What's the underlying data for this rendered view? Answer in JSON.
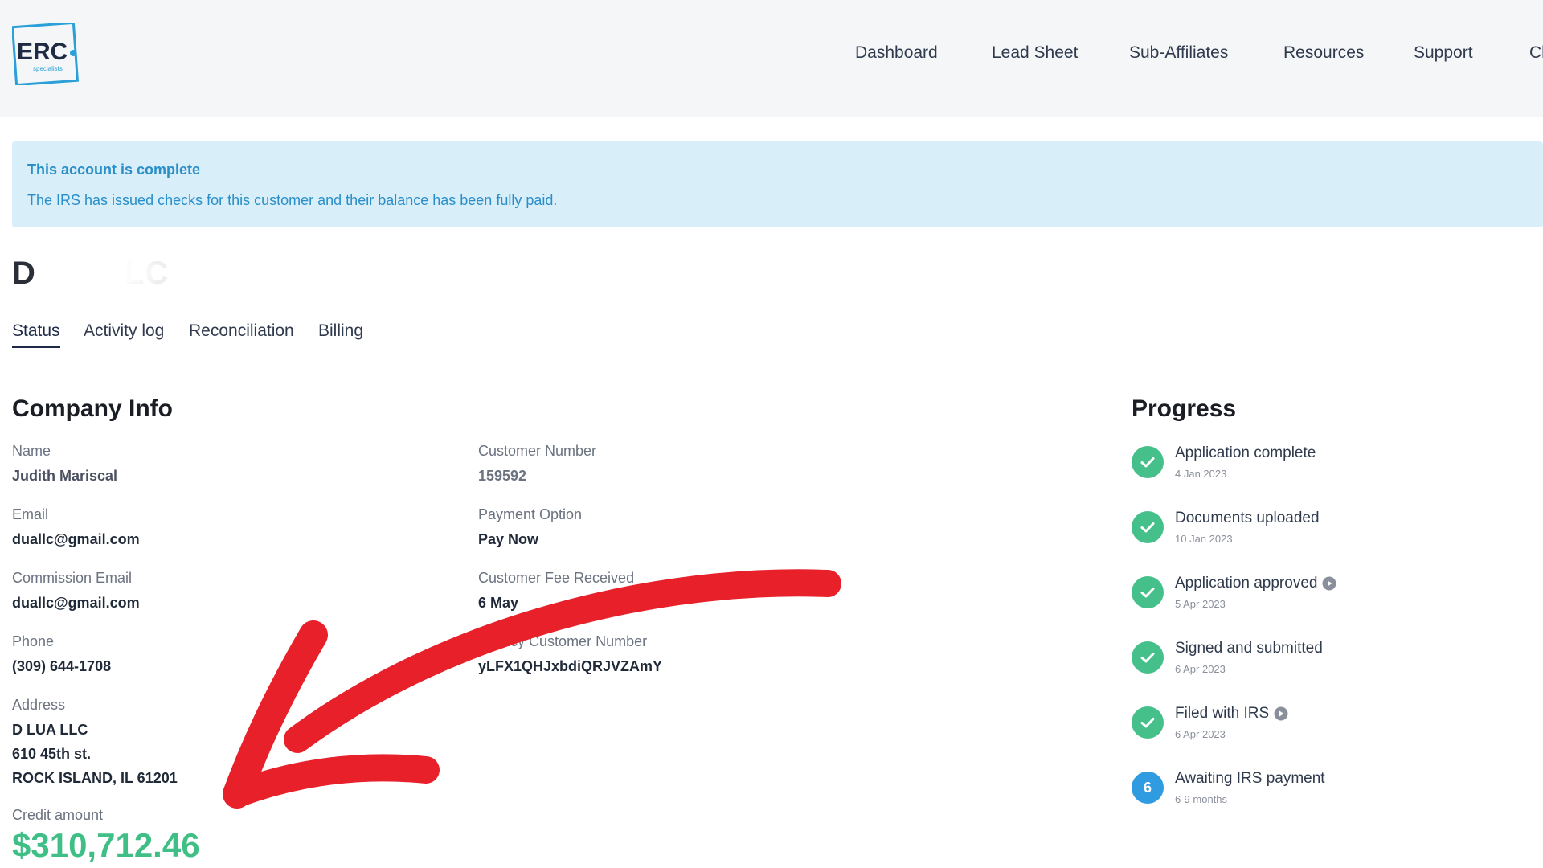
{
  "header": {
    "logo_text": "ERC",
    "logo_subtext": "specialists",
    "nav": [
      "Dashboard",
      "Lead Sheet",
      "Sub-Affiliates",
      "Resources",
      "Support",
      "Ch"
    ]
  },
  "banner": {
    "title": "This account is complete",
    "text": "The IRS has issued checks for this customer and their balance has been fully paid."
  },
  "company": {
    "title_start": "D",
    "title_end": "LC"
  },
  "tabs": [
    "Status",
    "Activity log",
    "Reconciliation",
    "Billing"
  ],
  "company_info": {
    "heading": "Company Info",
    "name_label": "Name",
    "name_value": "Judith Mariscal",
    "email_label": "Email",
    "email_value": "duallc@gmail.com",
    "commission_email_label": "Commission Email",
    "commission_email_value": "duallc@gmail.com",
    "phone_label": "Phone",
    "phone_value": "(309) 644-1708",
    "address_label": "Address",
    "address_line1": "D LUA LLC",
    "address_line2": "610 45th st.",
    "address_line3": "ROCK ISLAND, IL 61201",
    "credit_label": "Credit amount",
    "credit_value": "$310,712.46",
    "customer_number_label": "Customer Number",
    "customer_number_value": "159592",
    "payment_option_label": "Payment Option",
    "payment_option_value": "Pay Now",
    "fee_received_label": "Customer Fee Received",
    "fee_received_value": "6 May",
    "legacy_number_label": "Legacy Customer Number",
    "legacy_number_value": "yLFX1QHJxbdiQRJVZAmY"
  },
  "progress": {
    "heading": "Progress",
    "steps": [
      {
        "title": "Application complete",
        "date": "4 Jan 2023",
        "state": "done"
      },
      {
        "title": "Documents uploaded",
        "date": "10 Jan 2023",
        "state": "done"
      },
      {
        "title": "Application approved",
        "date": "5 Apr 2023",
        "state": "done"
      },
      {
        "title": "Signed and submitted",
        "date": "6 Apr 2023",
        "state": "done"
      },
      {
        "title": "Filed with IRS",
        "date": "6 Apr 2023",
        "state": "done"
      },
      {
        "title": "Awaiting IRS payment",
        "date": "6-9 months",
        "state": "current",
        "number": "6"
      }
    ]
  },
  "colors": {
    "accent_green": "#3fbf86",
    "check_green": "#45c08a",
    "current_blue": "#2f9be0",
    "banner_bg": "#d8eef9",
    "banner_text": "#2a8fc9",
    "arrow_red": "#e8202a"
  }
}
